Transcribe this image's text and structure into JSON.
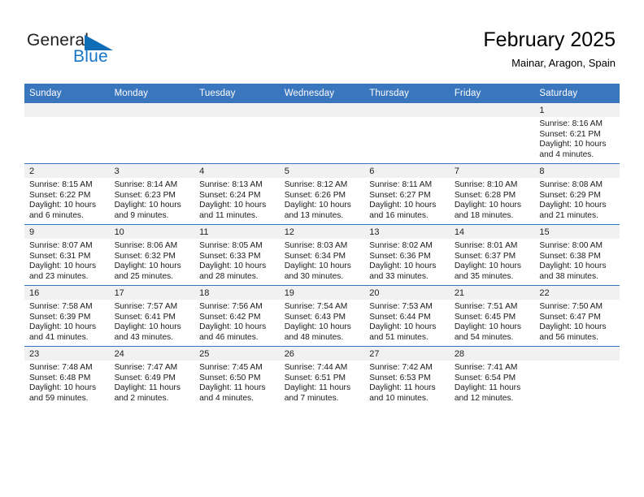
{
  "brand": {
    "name_part1": "General",
    "name_part2": "Blue",
    "triangle_color": "#0f6db5",
    "blue_text_color": "#1575c6"
  },
  "header": {
    "title": "February 2025",
    "subtitle": "Mainar, Aragon, Spain",
    "header_bg_color": "#3a76bd",
    "header_text_color": "#ffffff",
    "daynum_band_color": "#f1f1f1"
  },
  "weekday_headers": [
    "Sunday",
    "Monday",
    "Tuesday",
    "Wednesday",
    "Thursday",
    "Friday",
    "Saturday"
  ],
  "weeks": [
    [
      {
        "day": "",
        "sunrise": "",
        "sunset": "",
        "daylight": ""
      },
      {
        "day": "",
        "sunrise": "",
        "sunset": "",
        "daylight": ""
      },
      {
        "day": "",
        "sunrise": "",
        "sunset": "",
        "daylight": ""
      },
      {
        "day": "",
        "sunrise": "",
        "sunset": "",
        "daylight": ""
      },
      {
        "day": "",
        "sunrise": "",
        "sunset": "",
        "daylight": ""
      },
      {
        "day": "",
        "sunrise": "",
        "sunset": "",
        "daylight": ""
      },
      {
        "day": "1",
        "sunrise": "Sunrise: 8:16 AM",
        "sunset": "Sunset: 6:21 PM",
        "daylight": "Daylight: 10 hours and 4 minutes."
      }
    ],
    [
      {
        "day": "2",
        "sunrise": "Sunrise: 8:15 AM",
        "sunset": "Sunset: 6:22 PM",
        "daylight": "Daylight: 10 hours and 6 minutes."
      },
      {
        "day": "3",
        "sunrise": "Sunrise: 8:14 AM",
        "sunset": "Sunset: 6:23 PM",
        "daylight": "Daylight: 10 hours and 9 minutes."
      },
      {
        "day": "4",
        "sunrise": "Sunrise: 8:13 AM",
        "sunset": "Sunset: 6:24 PM",
        "daylight": "Daylight: 10 hours and 11 minutes."
      },
      {
        "day": "5",
        "sunrise": "Sunrise: 8:12 AM",
        "sunset": "Sunset: 6:26 PM",
        "daylight": "Daylight: 10 hours and 13 minutes."
      },
      {
        "day": "6",
        "sunrise": "Sunrise: 8:11 AM",
        "sunset": "Sunset: 6:27 PM",
        "daylight": "Daylight: 10 hours and 16 minutes."
      },
      {
        "day": "7",
        "sunrise": "Sunrise: 8:10 AM",
        "sunset": "Sunset: 6:28 PM",
        "daylight": "Daylight: 10 hours and 18 minutes."
      },
      {
        "day": "8",
        "sunrise": "Sunrise: 8:08 AM",
        "sunset": "Sunset: 6:29 PM",
        "daylight": "Daylight: 10 hours and 21 minutes."
      }
    ],
    [
      {
        "day": "9",
        "sunrise": "Sunrise: 8:07 AM",
        "sunset": "Sunset: 6:31 PM",
        "daylight": "Daylight: 10 hours and 23 minutes."
      },
      {
        "day": "10",
        "sunrise": "Sunrise: 8:06 AM",
        "sunset": "Sunset: 6:32 PM",
        "daylight": "Daylight: 10 hours and 25 minutes."
      },
      {
        "day": "11",
        "sunrise": "Sunrise: 8:05 AM",
        "sunset": "Sunset: 6:33 PM",
        "daylight": "Daylight: 10 hours and 28 minutes."
      },
      {
        "day": "12",
        "sunrise": "Sunrise: 8:03 AM",
        "sunset": "Sunset: 6:34 PM",
        "daylight": "Daylight: 10 hours and 30 minutes."
      },
      {
        "day": "13",
        "sunrise": "Sunrise: 8:02 AM",
        "sunset": "Sunset: 6:36 PM",
        "daylight": "Daylight: 10 hours and 33 minutes."
      },
      {
        "day": "14",
        "sunrise": "Sunrise: 8:01 AM",
        "sunset": "Sunset: 6:37 PM",
        "daylight": "Daylight: 10 hours and 35 minutes."
      },
      {
        "day": "15",
        "sunrise": "Sunrise: 8:00 AM",
        "sunset": "Sunset: 6:38 PM",
        "daylight": "Daylight: 10 hours and 38 minutes."
      }
    ],
    [
      {
        "day": "16",
        "sunrise": "Sunrise: 7:58 AM",
        "sunset": "Sunset: 6:39 PM",
        "daylight": "Daylight: 10 hours and 41 minutes."
      },
      {
        "day": "17",
        "sunrise": "Sunrise: 7:57 AM",
        "sunset": "Sunset: 6:41 PM",
        "daylight": "Daylight: 10 hours and 43 minutes."
      },
      {
        "day": "18",
        "sunrise": "Sunrise: 7:56 AM",
        "sunset": "Sunset: 6:42 PM",
        "daylight": "Daylight: 10 hours and 46 minutes."
      },
      {
        "day": "19",
        "sunrise": "Sunrise: 7:54 AM",
        "sunset": "Sunset: 6:43 PM",
        "daylight": "Daylight: 10 hours and 48 minutes."
      },
      {
        "day": "20",
        "sunrise": "Sunrise: 7:53 AM",
        "sunset": "Sunset: 6:44 PM",
        "daylight": "Daylight: 10 hours and 51 minutes."
      },
      {
        "day": "21",
        "sunrise": "Sunrise: 7:51 AM",
        "sunset": "Sunset: 6:45 PM",
        "daylight": "Daylight: 10 hours and 54 minutes."
      },
      {
        "day": "22",
        "sunrise": "Sunrise: 7:50 AM",
        "sunset": "Sunset: 6:47 PM",
        "daylight": "Daylight: 10 hours and 56 minutes."
      }
    ],
    [
      {
        "day": "23",
        "sunrise": "Sunrise: 7:48 AM",
        "sunset": "Sunset: 6:48 PM",
        "daylight": "Daylight: 10 hours and 59 minutes."
      },
      {
        "day": "24",
        "sunrise": "Sunrise: 7:47 AM",
        "sunset": "Sunset: 6:49 PM",
        "daylight": "Daylight: 11 hours and 2 minutes."
      },
      {
        "day": "25",
        "sunrise": "Sunrise: 7:45 AM",
        "sunset": "Sunset: 6:50 PM",
        "daylight": "Daylight: 11 hours and 4 minutes."
      },
      {
        "day": "26",
        "sunrise": "Sunrise: 7:44 AM",
        "sunset": "Sunset: 6:51 PM",
        "daylight": "Daylight: 11 hours and 7 minutes."
      },
      {
        "day": "27",
        "sunrise": "Sunrise: 7:42 AM",
        "sunset": "Sunset: 6:53 PM",
        "daylight": "Daylight: 11 hours and 10 minutes."
      },
      {
        "day": "28",
        "sunrise": "Sunrise: 7:41 AM",
        "sunset": "Sunset: 6:54 PM",
        "daylight": "Daylight: 11 hours and 12 minutes."
      },
      {
        "day": "",
        "sunrise": "",
        "sunset": "",
        "daylight": ""
      }
    ]
  ]
}
